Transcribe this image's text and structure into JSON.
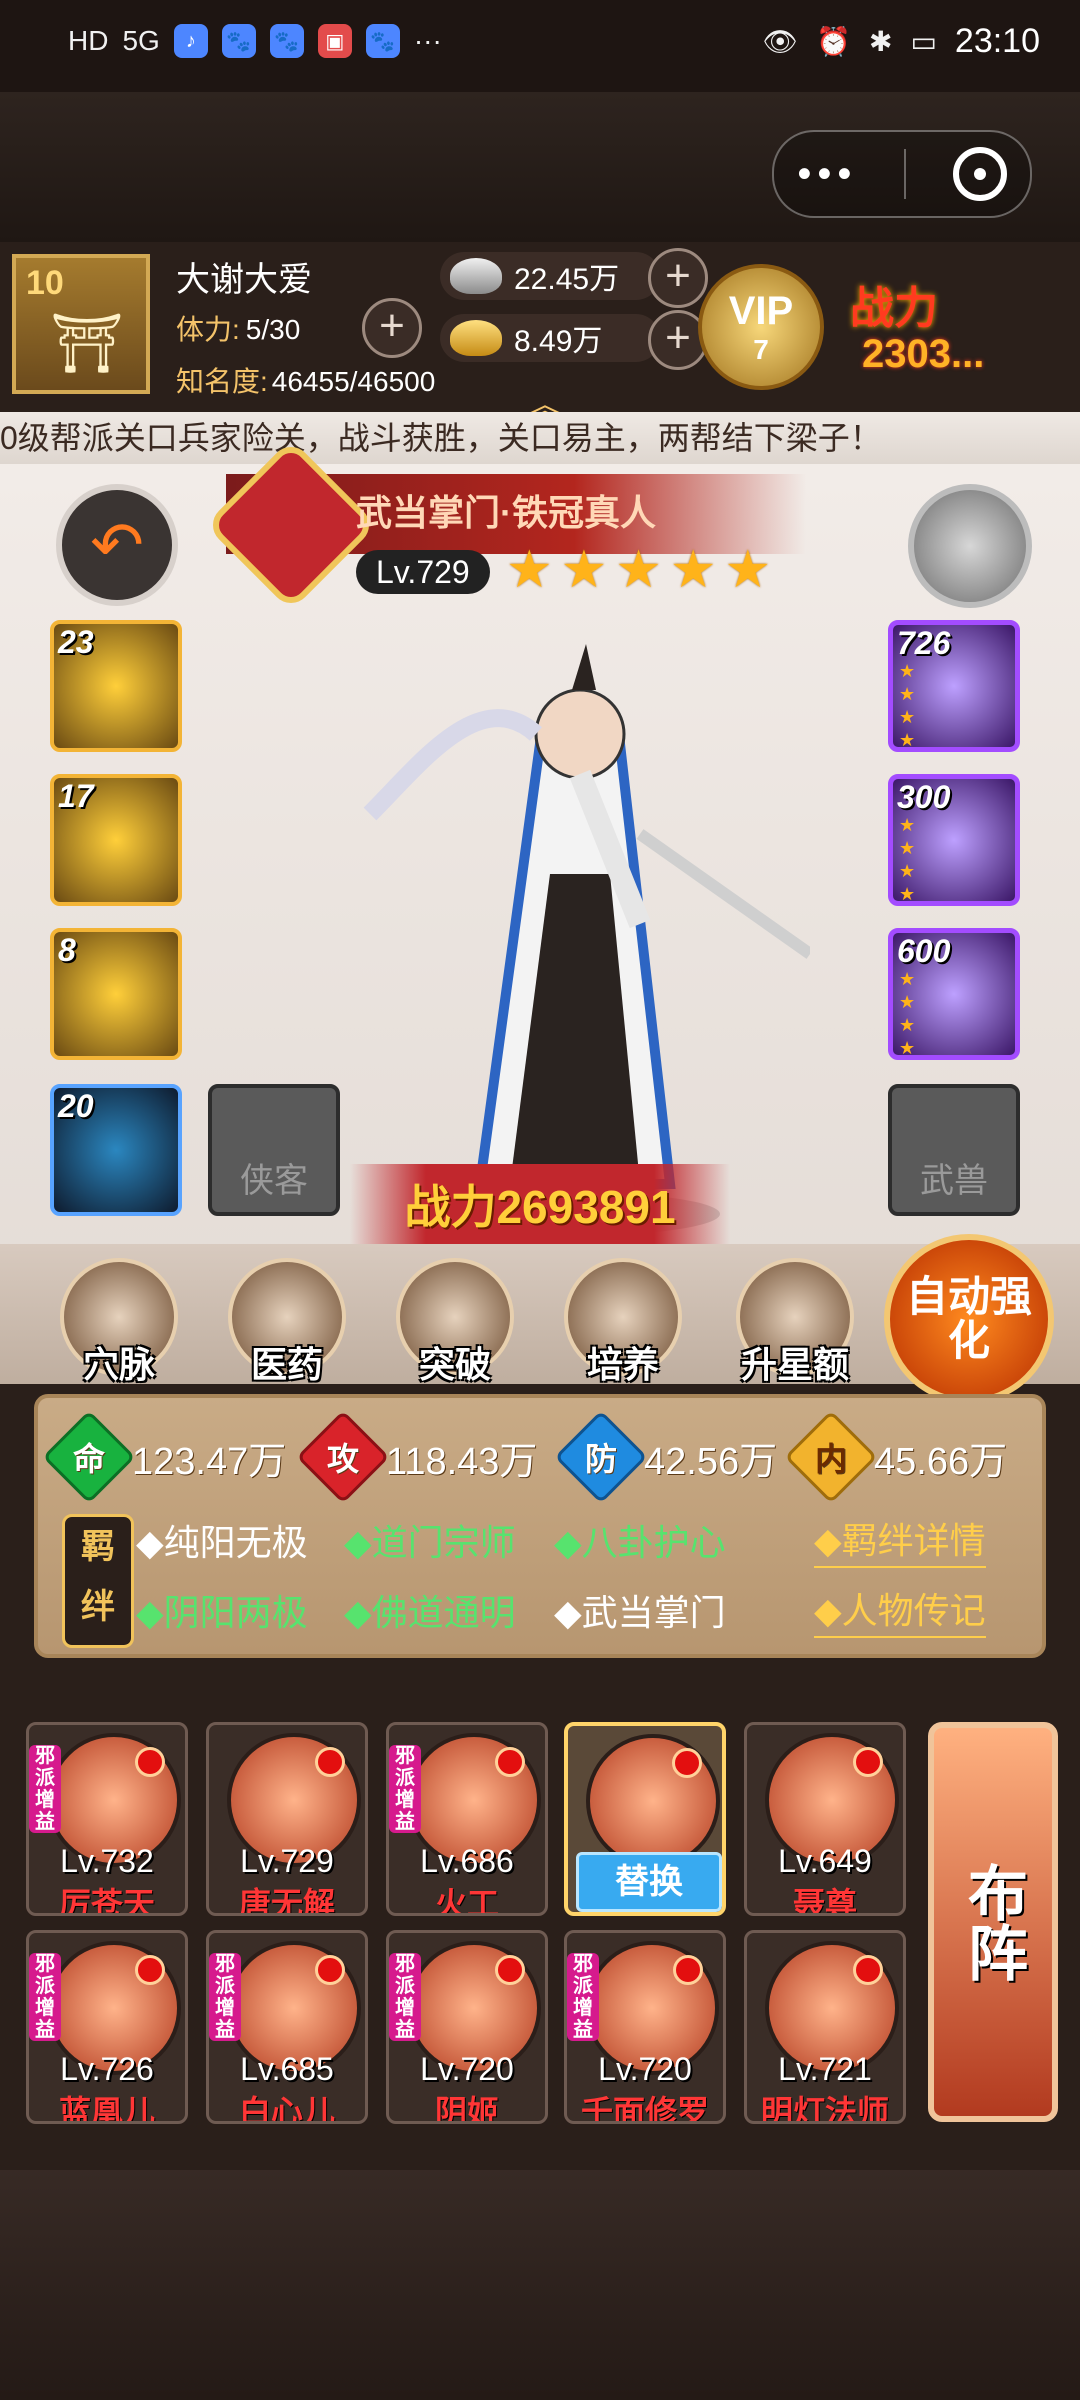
{
  "status_bar": {
    "left_badges": [
      "HD",
      "5G"
    ],
    "time": "23:10"
  },
  "player": {
    "level": "10",
    "name": "大谢大爱",
    "stamina_label": "体力:",
    "stamina_value": "5/30",
    "fame_label": "知名度:",
    "fame_value": "46455/46500",
    "silver": "22.45万",
    "gold": "8.49万",
    "vip_text": "VIP",
    "vip_level": "7",
    "power_label": "战力",
    "power_value": "2303..."
  },
  "marquee": "0级帮派关口兵家险关，战斗获胜，关口易主，两帮结下梁子！",
  "hero": {
    "title": "武当掌门·铁冠真人",
    "level": "Lv.729",
    "stars": 5,
    "power_text": "战力2693891"
  },
  "skills": [
    {
      "num": "23"
    },
    {
      "num": "17"
    },
    {
      "num": "8"
    },
    {
      "num": "20"
    }
  ],
  "equip": [
    {
      "num": "726"
    },
    {
      "num": "300"
    },
    {
      "num": "600"
    }
  ],
  "slots": {
    "partner": "侠客",
    "beast": "武兽"
  },
  "functions": [
    "穴脉",
    "医药",
    "突破",
    "培养",
    "升星额外"
  ],
  "auto_button": "自动强化",
  "stats": {
    "life_icon": "命",
    "life": "123.47万",
    "attack_icon": "攻",
    "attack": "118.43万",
    "defense_icon": "防",
    "defense": "42.56万",
    "inner_icon": "内",
    "inner": "45.66万"
  },
  "bonds": {
    "tag": "羁绊",
    "row1": [
      {
        "text": "◆纯阳无极",
        "color": "white"
      },
      {
        "text": "◆道门宗师",
        "color": "green"
      },
      {
        "text": "◆八卦护心",
        "color": "green"
      }
    ],
    "row2": [
      {
        "text": "◆阴阳两极",
        "color": "green"
      },
      {
        "text": "◆佛道通明",
        "color": "green"
      },
      {
        "text": "◆武当掌门",
        "color": "white"
      }
    ],
    "link_detail": "◆羁绊详情",
    "link_story": "◆人物传记"
  },
  "lineup": {
    "tag_text": "邪派增益",
    "row1": [
      {
        "level": "Lv.732",
        "name": "厉苍天",
        "tag": true
      },
      {
        "level": "Lv.729",
        "name": "唐无解",
        "tag": false
      },
      {
        "level": "Lv.686",
        "name": "火工",
        "tag": true
      },
      {
        "selected": true,
        "swap": "替换"
      },
      {
        "level": "Lv.649",
        "name": "聂尊",
        "tag": false
      }
    ],
    "row2": [
      {
        "level": "Lv.726",
        "name": "蓝凰儿",
        "tag": true
      },
      {
        "level": "Lv.685",
        "name": "白心儿",
        "tag": true
      },
      {
        "level": "Lv.720",
        "name": "阴姬",
        "tag": true
      },
      {
        "level": "Lv.720",
        "name": "千面修罗",
        "tag": true
      },
      {
        "level": "Lv.721",
        "name": "明灯法师",
        "tag": false
      }
    ],
    "formation": "布阵"
  }
}
